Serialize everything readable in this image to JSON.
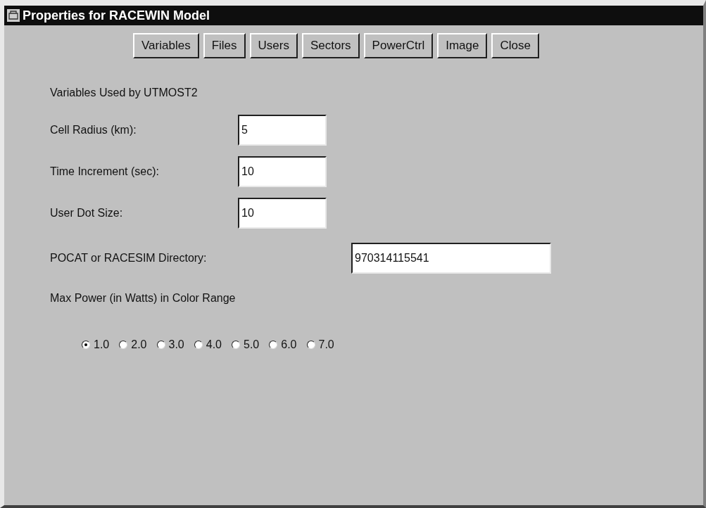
{
  "window": {
    "title": "Properties for RACEWIN Model"
  },
  "toolbar": {
    "buttons": [
      "Variables",
      "Files",
      "Users",
      "Sectors",
      "PowerCtrl",
      "Image",
      "Close"
    ]
  },
  "heading": "Variables Used by UTMOST2",
  "fields": [
    {
      "label": "Cell Radius (km):",
      "value": "5",
      "kind": "short"
    },
    {
      "label": "Time Increment (sec):",
      "value": "10",
      "kind": "short"
    },
    {
      "label": "User Dot Size:",
      "value": "10",
      "kind": "short"
    },
    {
      "label": "POCAT or RACESIM Directory:",
      "value": "970314115541",
      "kind": "long"
    }
  ],
  "power": {
    "label": "Max Power (in Watts) in Color Range",
    "options": [
      {
        "label": "1.0",
        "selected": true
      },
      {
        "label": "2.0",
        "selected": false
      },
      {
        "label": "3.0",
        "selected": false
      },
      {
        "label": "4.0",
        "selected": false
      },
      {
        "label": "5.0",
        "selected": false
      },
      {
        "label": "6.0",
        "selected": false
      },
      {
        "label": "7.0",
        "selected": false
      }
    ]
  }
}
